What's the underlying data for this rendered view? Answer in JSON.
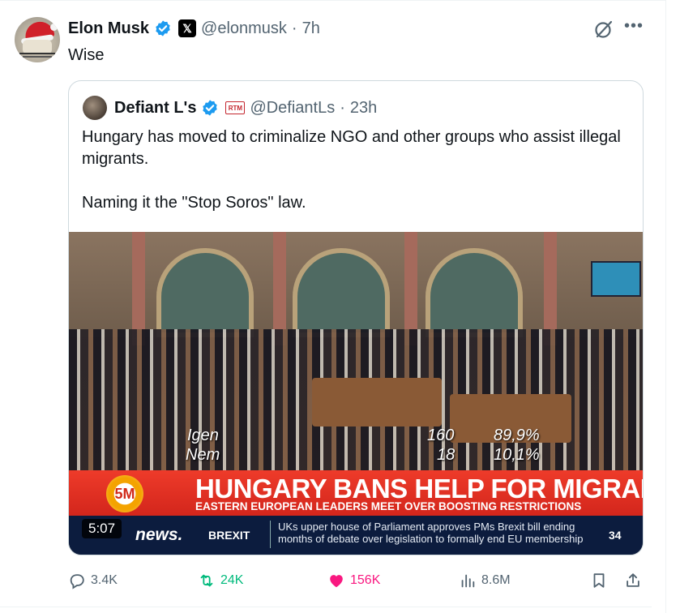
{
  "post": {
    "author_name": "Elon Musk",
    "handle": "@elonmusk",
    "separator": "·",
    "time": "7h",
    "text": "Wise"
  },
  "quote": {
    "author_name": "Defiant L's",
    "handle": "@DefiantLs",
    "separator": "·",
    "time": "23h",
    "badge_label": "RTM",
    "paragraph1": "Hungary has moved to criminalize NGO and other groups who assist illegal migrants.",
    "paragraph2": "Naming it the \"Stop Soros\" law."
  },
  "video": {
    "duration": "5:07",
    "vote_yes_label": "Igen",
    "vote_no_label": "Nem",
    "vote_yes_count": "160",
    "vote_no_count": "18",
    "vote_yes_pct": "89,9%",
    "vote_no_pct": "10,1%",
    "logo_text": "5M",
    "headline": "HUNGARY BANS HELP FOR MIGRANTS",
    "subline": "EASTERN EUROPEAN LEADERS MEET OVER BOOSTING RESTRICTIONS",
    "network": "news.",
    "section": "BREXIT",
    "ticker": "UKs upper house of Parliament approves PMs Brexit bill ending months of debate over legislation to formally end EU membership",
    "channel_number": "34"
  },
  "actions": {
    "replies": "3.4K",
    "reposts": "24K",
    "likes": "156K",
    "views": "8.6M"
  },
  "colors": {
    "verified": "#1d9bf0",
    "repost": "#00ba7c",
    "like": "#f91880",
    "secondary_text": "#536471"
  }
}
